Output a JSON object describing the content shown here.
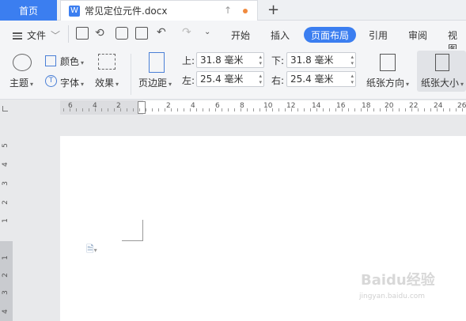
{
  "tabs": {
    "home": "首页",
    "doc_title": "常见定位元件.docx"
  },
  "menu": {
    "file": "文件",
    "items": [
      "开始",
      "插入",
      "页面布局",
      "引用",
      "审阅",
      "视图"
    ],
    "active": "页面布局"
  },
  "ribbon": {
    "theme": "主题",
    "color": "颜色",
    "font": "字体",
    "effect": "效果",
    "margins": "页边距",
    "top_label": "上:",
    "top_value": "31.8 毫米",
    "bottom_label": "下:",
    "bottom_value": "31.8 毫米",
    "left_label": "左:",
    "left_value": "25.4 毫米",
    "right_label": "右:",
    "right_value": "25.4 毫米",
    "orientation": "纸张方向",
    "size": "纸张大小"
  },
  "ruler": {
    "h_numbers": [
      "6",
      "4",
      "2",
      "2",
      "4",
      "6",
      "8",
      "10",
      "12",
      "14",
      "16",
      "18",
      "20",
      "22",
      "24",
      "26",
      "28"
    ],
    "v_numbers": [
      "5",
      "4",
      "3",
      "2",
      "1",
      "1",
      "2",
      "3",
      "4"
    ]
  },
  "watermark": {
    "brand": "Baidu经验",
    "url": "jingyan.baidu.com"
  }
}
